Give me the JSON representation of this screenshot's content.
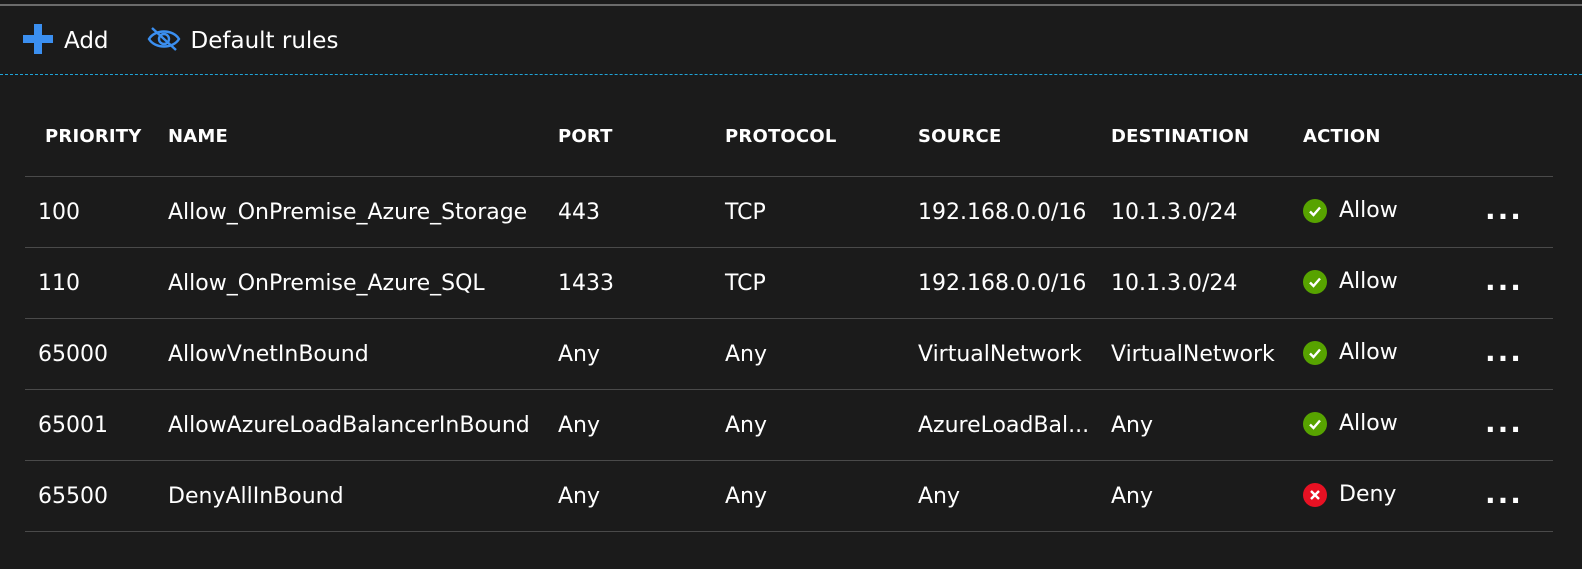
{
  "toolbar": {
    "add_label": "Add",
    "default_rules_label": "Default rules"
  },
  "colors": {
    "accent": "#1fa4d8",
    "add_icon": "#3b8ff0",
    "allow": "#57a300",
    "deny": "#e81123"
  },
  "table": {
    "headers": {
      "priority": "PRIORITY",
      "name": "NAME",
      "port": "PORT",
      "protocol": "PROTOCOL",
      "source": "SOURCE",
      "destination": "DESTINATION",
      "action": "ACTION"
    },
    "rows": [
      {
        "priority": "100",
        "name": "Allow_OnPremise_Azure_Storage",
        "port": "443",
        "protocol": "TCP",
        "source": "192.168.0.0/16",
        "destination": "10.1.3.0/24",
        "action": "Allow",
        "action_icon": "check-circle-icon",
        "more": "..."
      },
      {
        "priority": "110",
        "name": "Allow_OnPremise_Azure_SQL",
        "port": "1433",
        "protocol": "TCP",
        "source": "192.168.0.0/16",
        "destination": "10.1.3.0/24",
        "action": "Allow",
        "action_icon": "check-circle-icon",
        "more": "..."
      },
      {
        "priority": "65000",
        "name": "AllowVnetInBound",
        "port": "Any",
        "protocol": "Any",
        "source": "VirtualNetwork",
        "destination": "VirtualNetwork",
        "action": "Allow",
        "action_icon": "check-circle-icon",
        "more": "..."
      },
      {
        "priority": "65001",
        "name": "AllowAzureLoadBalancerInBound",
        "port": "Any",
        "protocol": "Any",
        "source": "AzureLoadBal...",
        "destination": "Any",
        "action": "Allow",
        "action_icon": "check-circle-icon",
        "more": "..."
      },
      {
        "priority": "65500",
        "name": "DenyAllInBound",
        "port": "Any",
        "protocol": "Any",
        "source": "Any",
        "destination": "Any",
        "action": "Deny",
        "action_icon": "x-circle-icon",
        "more": "..."
      }
    ]
  }
}
